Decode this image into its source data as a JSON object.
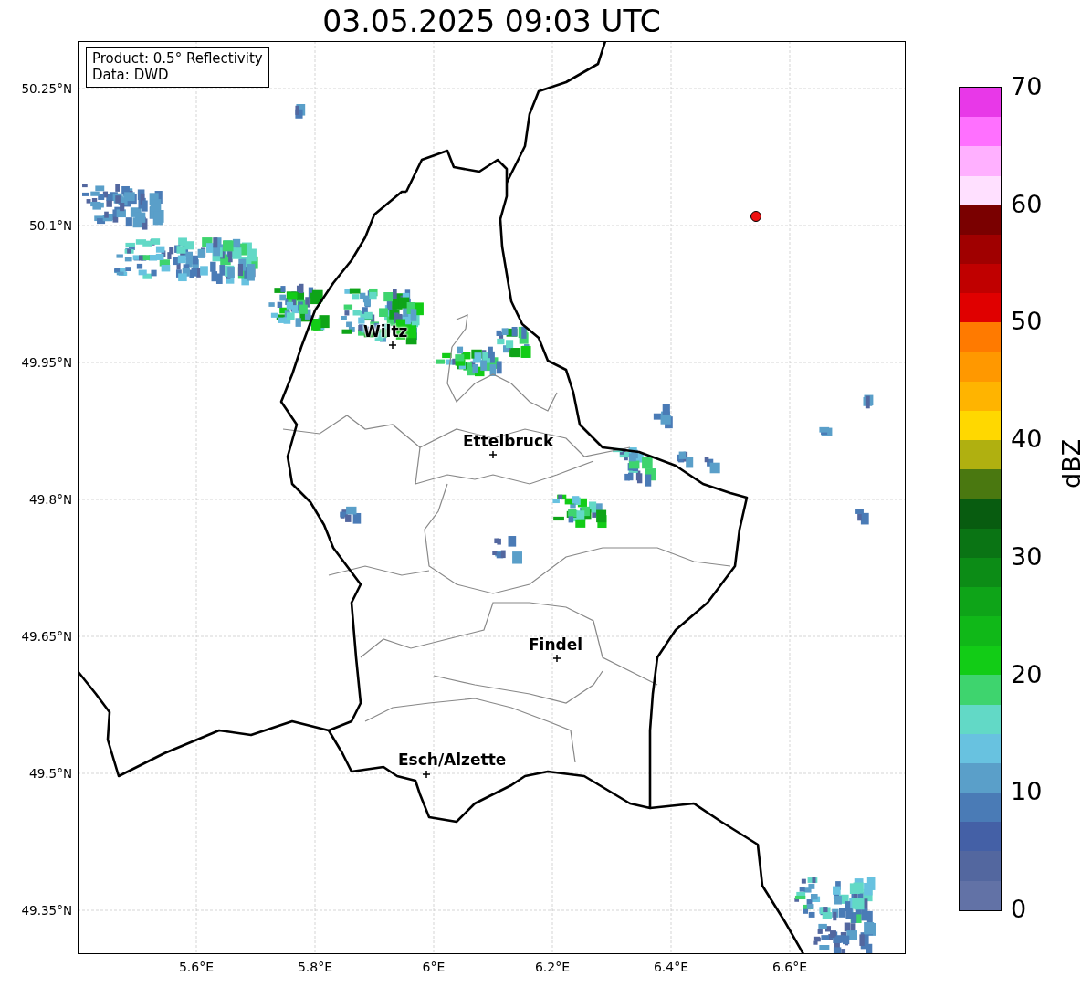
{
  "title": "03.05.2025 09:03 UTC",
  "info_box": [
    "Product: 0.5° Reflectivity",
    "Data: DWD"
  ],
  "map": {
    "y_ticks": [
      "50.25°N",
      "50.1°N",
      "49.95°N",
      "49.8°N",
      "49.65°N",
      "49.5°N",
      "49.35°N"
    ],
    "x_ticks": [
      "5.6°E",
      "5.8°E",
      "6°E",
      "6.2°E",
      "6.4°E",
      "6.6°E"
    ],
    "cities": [
      {
        "name": "Wiltz"
      },
      {
        "name": "Ettelbruck"
      },
      {
        "name": "Findel"
      },
      {
        "name": "Esch/Alzette"
      }
    ]
  },
  "colorbar": {
    "label": "dBZ",
    "ticks": [
      "70",
      "60",
      "50",
      "40",
      "30",
      "20",
      "10",
      "0"
    ],
    "segments": [
      {
        "color": "#6272a6"
      },
      {
        "color": "#53679f"
      },
      {
        "color": "#4460a6"
      },
      {
        "color": "#4a7bb6"
      },
      {
        "color": "#5a9fc9"
      },
      {
        "color": "#68c2e0"
      },
      {
        "color": "#62d9c6"
      },
      {
        "color": "#3ed46e"
      },
      {
        "color": "#12cc16"
      },
      {
        "color": "#10b818"
      },
      {
        "color": "#0ea418"
      },
      {
        "color": "#0c8c16"
      },
      {
        "color": "#0a7414"
      },
      {
        "color": "#085c10"
      },
      {
        "color": "#4a7810"
      },
      {
        "color": "#b0b010"
      },
      {
        "color": "#ffd800"
      },
      {
        "color": "#ffb400"
      },
      {
        "color": "#ff9800"
      },
      {
        "color": "#ff7a00"
      },
      {
        "color": "#e00000"
      },
      {
        "color": "#c00000"
      },
      {
        "color": "#a00000"
      },
      {
        "color": "#7a0000"
      },
      {
        "color": "#ffe0ff"
      },
      {
        "color": "#ffb0ff"
      },
      {
        "color": "#ff70ff"
      },
      {
        "color": "#e838e8"
      }
    ]
  }
}
